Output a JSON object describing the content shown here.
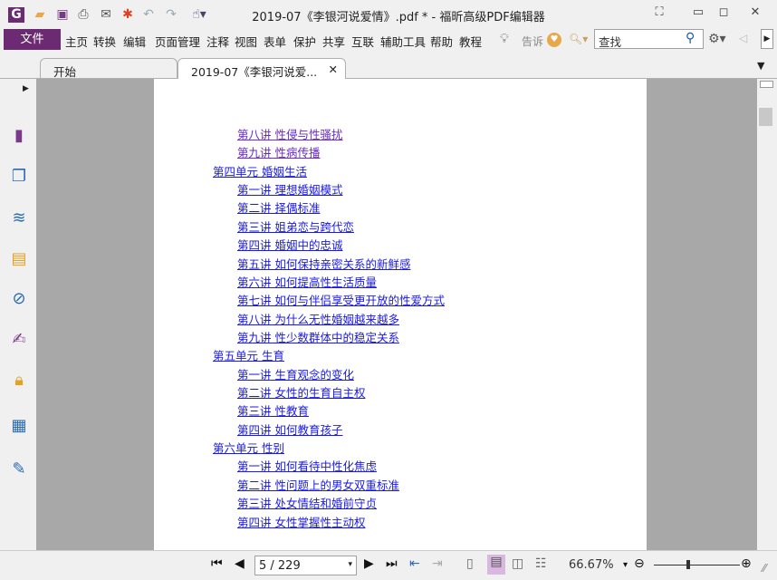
{
  "window": {
    "title": "2019-07《李银河说爱情》.pdf * - 福昕高级PDF编辑器"
  },
  "menu": {
    "file": "文件",
    "items": [
      "主页",
      "转换",
      "编辑",
      "页面管理",
      "注释",
      "视图",
      "表单",
      "保护",
      "共享",
      "互联",
      "辅助工具",
      "帮助",
      "教程"
    ],
    "tell_me": "告诉"
  },
  "search": {
    "placeholder": "查找"
  },
  "tabs": [
    {
      "label": "开始"
    },
    {
      "label": "2019-07《李银河说爱...",
      "active": true
    }
  ],
  "toc": [
    {
      "t": "第八讲 性侵与性骚扰",
      "l": 2,
      "visited": true
    },
    {
      "t": "第九讲 性病传播",
      "l": 2,
      "visited": true
    },
    {
      "t": "第四单元 婚姻生活",
      "l": 1
    },
    {
      "t": "第一讲 理想婚姻模式",
      "l": 2
    },
    {
      "t": "第二讲 择偶标准",
      "l": 2
    },
    {
      "t": "第三讲 姐弟恋与跨代恋",
      "l": 2
    },
    {
      "t": "第四讲 婚姻中的忠诚",
      "l": 2
    },
    {
      "t": "第五讲 如何保持亲密关系的新鲜感",
      "l": 2
    },
    {
      "t": "第六讲 如何提高性生活质量",
      "l": 2
    },
    {
      "t": "第七讲 如何与伴侣享受更开放的性爱方式",
      "l": 2
    },
    {
      "t": "第八讲 为什么无性婚姻越来越多",
      "l": 2
    },
    {
      "t": "第九讲 性少数群体中的稳定关系",
      "l": 2
    },
    {
      "t": "第五单元 生育",
      "l": 1
    },
    {
      "t": "第一讲 生育观念的变化",
      "l": 2
    },
    {
      "t": "第二讲 女性的生育自主权",
      "l": 2
    },
    {
      "t": "第三讲 性教育",
      "l": 2
    },
    {
      "t": "第四讲 如何教育孩子",
      "l": 2
    },
    {
      "t": "第六单元 性别",
      "l": 1
    },
    {
      "t": "第一讲 如何看待中性化焦虑",
      "l": 2
    },
    {
      "t": "第二讲 性问题上的男女双重标准",
      "l": 2
    },
    {
      "t": "第三讲 处女情结和婚前守贞",
      "l": 2
    },
    {
      "t": "第四讲 女性掌握性主动权",
      "l": 2
    }
  ],
  "status": {
    "page": "5 / 229",
    "zoom": "66.67%",
    "zoom_slider_fraction": 0.4
  },
  "colors": {
    "brand": "#6b2a72",
    "link": "#1a1ae6",
    "visited": "#6a2bc8"
  }
}
